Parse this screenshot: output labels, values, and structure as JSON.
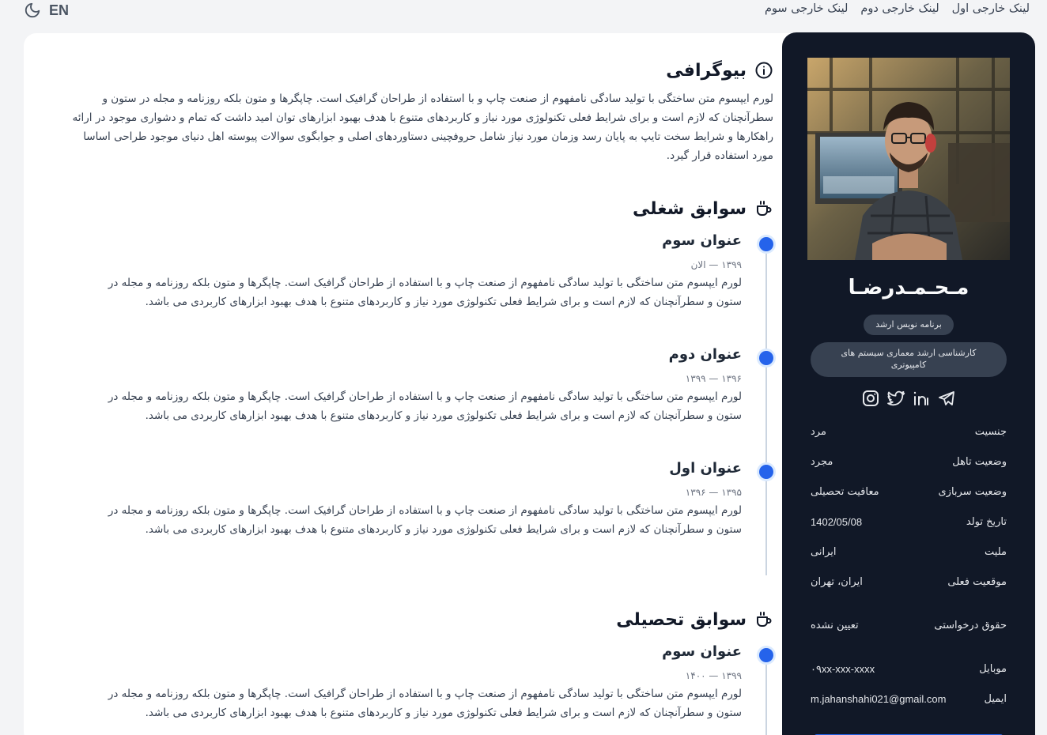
{
  "header": {
    "lang": "EN",
    "links": [
      "لینک خارجی اول",
      "لینک خارجی دوم",
      "لینک خارجی سوم"
    ]
  },
  "bio": {
    "title": "بیوگرافی",
    "text": "لورم ایپسوم متن ساختگی با تولید سادگی نامفهوم از صنعت چاپ و با استفاده از طراحان گرافیک است. چاپگرها و متون بلکه روزنامه و مجله در ستون و سطرآنچنان که لازم است و برای شرایط فعلی تکنولوژی مورد نیاز و کاربردهای متنوع با هدف بهبود ابزارهای توان امید داشت که تمام و دشواری موجود در ارائه راهکارها و شرایط سخت تایپ به پایان رسد وزمان مورد نیاز شامل حروفچینی دستاوردهای اصلی و جوابگوی سوالات پیوسته اهل دنیای موجود طراحی اساسا مورد استفاده قرار گیرد."
  },
  "work": {
    "title": "سوابق شغلی",
    "items": [
      {
        "title": "عنوان سوم",
        "date": "۱۳۹۹ — الان",
        "desc": "لورم ایپسوم متن ساختگی با تولید سادگی نامفهوم از صنعت چاپ و با استفاده از طراحان گرافیک است. چاپگرها و متون بلکه روزنامه و مجله در ستون و سطرآنچنان که لازم است و برای شرایط فعلی تکنولوژی مورد نیاز و کاربردهای متنوع با هدف بهبود ابزارهای کاربردی می باشد."
      },
      {
        "title": "عنوان دوم",
        "date": "۱۳۹۶ — ۱۳۹۹",
        "desc": "لورم ایپسوم متن ساختگی با تولید سادگی نامفهوم از صنعت چاپ و با استفاده از طراحان گرافیک است. چاپگرها و متون بلکه روزنامه و مجله در ستون و سطرآنچنان که لازم است و برای شرایط فعلی تکنولوژی مورد نیاز و کاربردهای متنوع با هدف بهبود ابزارهای کاربردی می باشد."
      },
      {
        "title": "عنوان اول",
        "date": "۱۳۹۵ — ۱۳۹۶",
        "desc": "لورم ایپسوم متن ساختگی با تولید سادگی نامفهوم از صنعت چاپ و با استفاده از طراحان گرافیک است. چاپگرها و متون بلکه روزنامه و مجله در ستون و سطرآنچنان که لازم است و برای شرایط فعلی تکنولوژی مورد نیاز و کاربردهای متنوع با هدف بهبود ابزارهای کاربردی می باشد."
      }
    ]
  },
  "education": {
    "title": "سوابق تحصیلی",
    "items": [
      {
        "title": "عنوان سوم",
        "date": "۱۳۹۹ — ۱۴۰۰",
        "desc": "لورم ایپسوم متن ساختگی با تولید سادگی نامفهوم از صنعت چاپ و با استفاده از طراحان گرافیک است. چاپگرها و متون بلکه روزنامه و مجله در ستون و سطرآنچنان که لازم است و برای شرایط فعلی تکنولوژی مورد نیاز و کاربردهای متنوع با هدف بهبود ابزارهای کاربردی می باشد."
      }
    ]
  },
  "profile": {
    "name": "مـحـمـدرضـا",
    "role": "برنامه نویس ارشد",
    "degree": "کارشناسی ارشد معماری سیستم های کامپیوتری",
    "socials": [
      "instagram-icon",
      "twitter-icon",
      "linkedin-icon",
      "telegram-icon"
    ],
    "info": [
      {
        "label": "جنسیت",
        "value": "مرد"
      },
      {
        "label": "وضعیت تاهل",
        "value": "مجرد"
      },
      {
        "label": "وضعیت سربازی",
        "value": "معافیت تحصیلی"
      },
      {
        "label": "تاریخ تولد",
        "value": "1402/05/08"
      },
      {
        "label": "ملیت",
        "value": "ایرانی"
      },
      {
        "label": "موقعیت فعلی",
        "value": "ایران، تهران"
      },
      {
        "label": "حقوق درخواستی",
        "value": "تعیین نشده"
      },
      {
        "label": "موبایل",
        "value": "۰۹xx-xxx-xxxx"
      },
      {
        "label": "ایمیل",
        "value": "m.jahanshahi021@gmail.com"
      }
    ]
  },
  "colors": {
    "accent": "#2563eb",
    "sidebar": "#111827",
    "background": "#f3f4f6"
  }
}
